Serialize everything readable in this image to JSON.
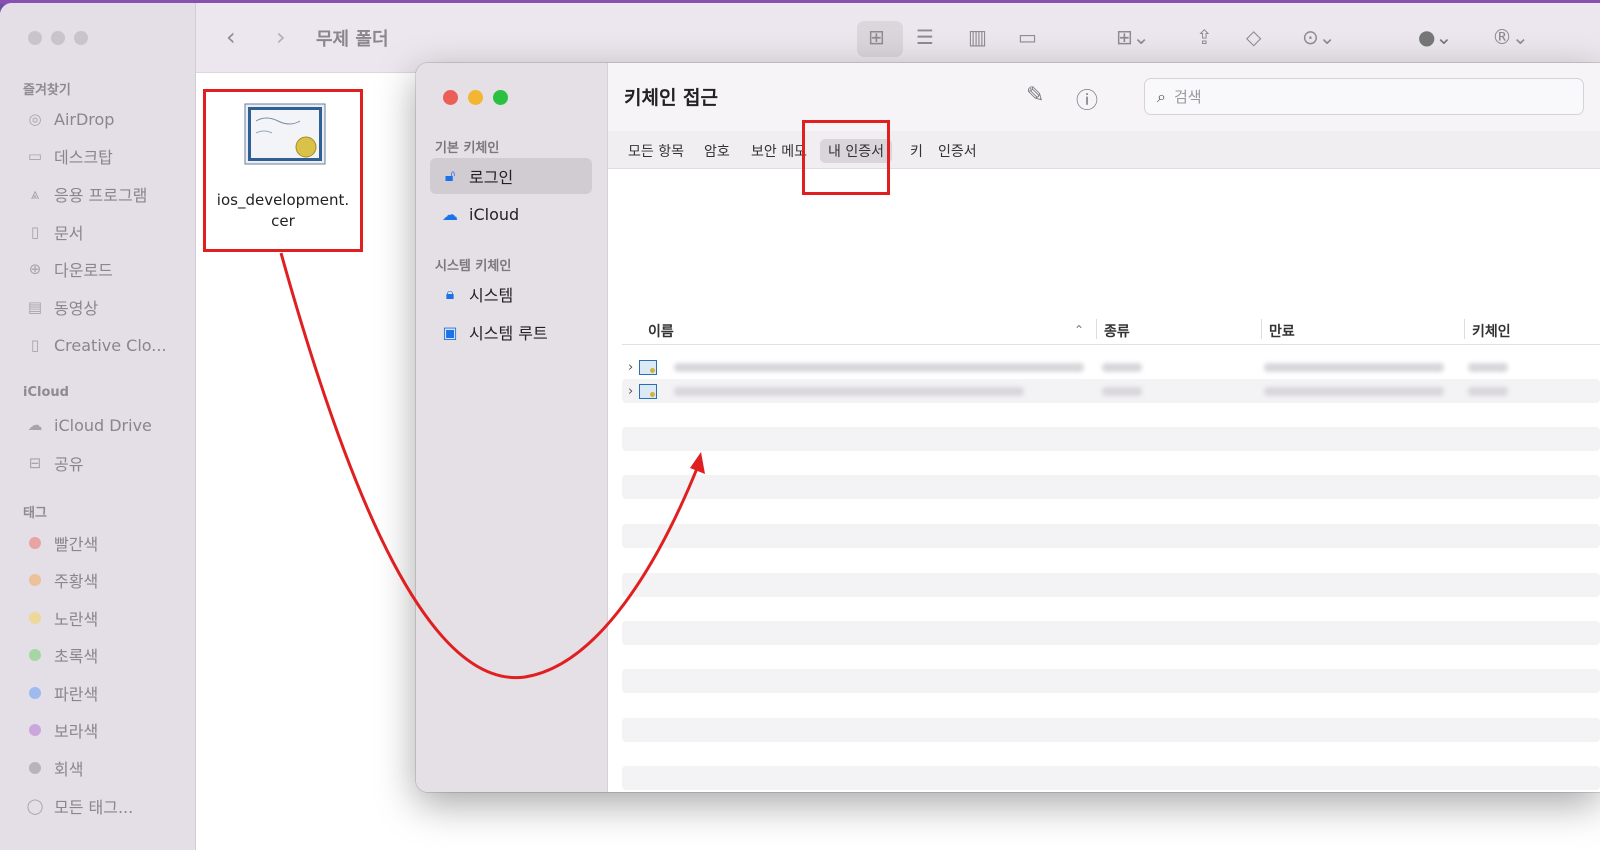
{
  "finder": {
    "folder_title": "무제 폴더",
    "sidebar": {
      "favorites_label": "즐겨찾기",
      "favorites": [
        {
          "label": "AirDrop",
          "icon": "airdrop-icon"
        },
        {
          "label": "데스크탑",
          "icon": "desktop-icon"
        },
        {
          "label": "응용 프로그램",
          "icon": "applications-icon"
        },
        {
          "label": "문서",
          "icon": "document-icon"
        },
        {
          "label": "다운로드",
          "icon": "download-icon"
        },
        {
          "label": "동영상",
          "icon": "movies-icon"
        },
        {
          "label": "Creative Clo...",
          "icon": "file-icon"
        }
      ],
      "icloud_label": "iCloud",
      "icloud": [
        {
          "label": "iCloud Drive",
          "icon": "cloud-icon"
        },
        {
          "label": "공유",
          "icon": "shared-folder-icon"
        }
      ],
      "tags_label": "태그",
      "tags": [
        {
          "label": "빨간색",
          "color": "#e8a3a3"
        },
        {
          "label": "주황색",
          "color": "#ebc199"
        },
        {
          "label": "노란색",
          "color": "#ecd99a"
        },
        {
          "label": "초록색",
          "color": "#a7d6a5"
        },
        {
          "label": "파란색",
          "color": "#9fbaee"
        },
        {
          "label": "보라색",
          "color": "#c9a7dd"
        },
        {
          "label": "회색",
          "color": "#b7b3b9"
        },
        {
          "label": "모든 태그...",
          "color": ""
        }
      ]
    },
    "file": {
      "name_line1": "ios_development.",
      "name_line2": "cer"
    }
  },
  "keychain": {
    "title": "키체인 접근",
    "search_placeholder": "검색",
    "sidebar": {
      "default_label": "기본 키체인",
      "default_items": [
        {
          "label": "로그인",
          "icon": "unlock-icon",
          "selected": true
        },
        {
          "label": "iCloud",
          "icon": "icloud-key-icon",
          "selected": false
        }
      ],
      "system_label": "시스템 키체인",
      "system_items": [
        {
          "label": "시스템",
          "icon": "lock-icon"
        },
        {
          "label": "시스템 루트",
          "icon": "system-root-icon"
        }
      ]
    },
    "tabs": [
      {
        "label": "모든 항목",
        "selected": false
      },
      {
        "label": "암호",
        "selected": false
      },
      {
        "label": "보안 메모",
        "selected": false
      },
      {
        "label": "내 인증서",
        "selected": true
      },
      {
        "label": "키",
        "selected": false
      },
      {
        "label": "인증서",
        "selected": false
      }
    ],
    "columns": {
      "name": "이름",
      "kind": "종류",
      "expires": "만료",
      "keychain": "키체인"
    }
  },
  "colors": {
    "highlight": "#e02020",
    "accent": "#1a73e8"
  }
}
